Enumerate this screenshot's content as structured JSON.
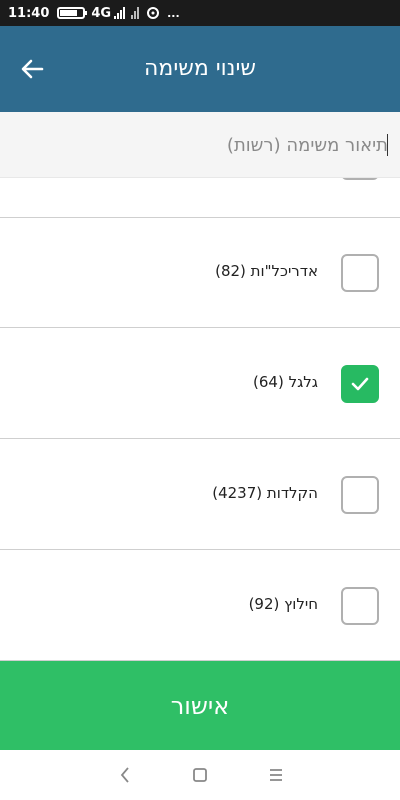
{
  "status": {
    "time": "11:40",
    "network": "4G",
    "more": "...",
    "battery_level": 0.75
  },
  "header": {
    "title": "שינוי משימה",
    "back_icon": "arrow-left-icon"
  },
  "description": {
    "placeholder": "תיאור משימה (רשות)",
    "value": ""
  },
  "items": [
    {
      "label": "",
      "checked": false
    },
    {
      "label": "אדריכל\"ות (82)",
      "checked": false
    },
    {
      "label": "גלגל (64)",
      "checked": true
    },
    {
      "label": "הקלדות (4237)",
      "checked": false
    },
    {
      "label": "חילוץ (92)",
      "checked": false
    }
  ],
  "confirm": {
    "label": "אישור"
  },
  "colors": {
    "app_bar": "#2f6b8e",
    "confirm": "#2fbf66",
    "checked": "#27ba62"
  }
}
